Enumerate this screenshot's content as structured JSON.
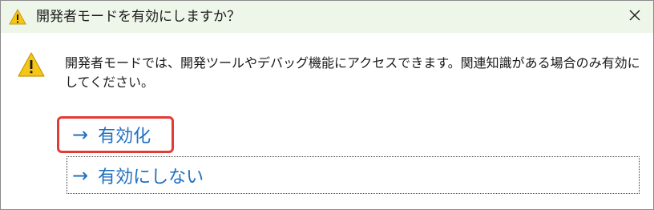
{
  "dialog": {
    "title": "開発者モードを有効にしますか？",
    "message": "開発者モードでは、開発ツールやデバッグ機能にアクセスできます。関連知識がある場合のみ有効にしてください。",
    "close_icon": "close-icon",
    "warning_icon": "warning-icon"
  },
  "commands": {
    "arrow": "→",
    "enable_label": "有効化",
    "disable_label": "有効にしない"
  },
  "colors": {
    "titlebar_bg": "#eef6ea",
    "command_text": "#1f6fbf",
    "highlight_border": "#e53935",
    "warning_fill": "#f5c518"
  }
}
